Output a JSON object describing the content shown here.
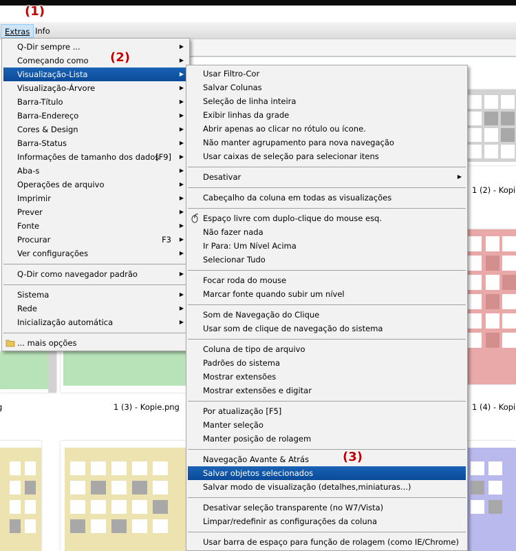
{
  "menubar": {
    "extras": "Extras",
    "info": "Info"
  },
  "annotations": {
    "one": "(1)",
    "two": "(2)",
    "three": "(3)"
  },
  "captions": {
    "c1": "1 (2) - Kopie",
    "c2": "1 (3) - Kopie.png",
    "c3": "1 (4) - Kopie",
    "c4": "g"
  },
  "extras_menu": {
    "items": [
      {
        "label": "Q-Dir sempre ...",
        "arrow": "▶"
      },
      {
        "label": "Começando como",
        "arrow": "▶"
      },
      {
        "label": "Visualização-Lista",
        "arrow": "▶"
      },
      {
        "label": "Visualização-Árvore",
        "arrow": "▶"
      },
      {
        "label": "Barra-Título",
        "arrow": "▶"
      },
      {
        "label": "Barra-Endereço",
        "arrow": "▶"
      },
      {
        "label": "Cores & Design",
        "arrow": "▶"
      },
      {
        "label": "Barra-Status",
        "arrow": "▶"
      },
      {
        "label": "Informações de tamanho dos dados",
        "shortcut": "[F9]",
        "arrow": "▶"
      },
      {
        "label": "Aba-s",
        "arrow": "▶"
      },
      {
        "label": "Operações de arquivo",
        "arrow": "▶"
      },
      {
        "label": "Imprimir",
        "arrow": "▶"
      },
      {
        "label": "Prever",
        "arrow": "▶"
      },
      {
        "label": "Fonte",
        "arrow": "▶"
      },
      {
        "label": "Procurar",
        "shortcut": "F3",
        "arrow": "▶"
      },
      {
        "label": "Ver configurações",
        "arrow": "▶"
      },
      {
        "label": "Q-Dir como navegador padrão",
        "arrow": "▶"
      },
      {
        "label": "Sistema",
        "arrow": "▶"
      },
      {
        "label": "Rede",
        "arrow": "▶"
      },
      {
        "label": "Inicialização automática",
        "arrow": "▶"
      },
      {
        "label": "... mais opções"
      }
    ]
  },
  "list_menu": {
    "items": [
      {
        "label": "Usar Filtro-Cor"
      },
      {
        "label": "Salvar Colunas"
      },
      {
        "label": "Seleção de linha inteira"
      },
      {
        "label": "Exibir linhas da grade"
      },
      {
        "label": "Abrir apenas ao clicar no rótulo ou ícone."
      },
      {
        "label": "Não manter agrupamento para nova navegação"
      },
      {
        "label": "Usar caixas de seleção para selecionar itens"
      },
      {
        "label": "Desativar",
        "arrow": "▶"
      },
      {
        "label": "Cabeçalho da coluna em todas as visualizações"
      },
      {
        "label": "Espaço livre com duplo-clique do mouse esq."
      },
      {
        "label": "Não fazer nada"
      },
      {
        "label": "Ir Para: Um Nível Acima"
      },
      {
        "label": "Selecionar Tudo"
      },
      {
        "label": "Focar roda do mouse"
      },
      {
        "label": "Marcar fonte quando subir um nível"
      },
      {
        "label": "Som de Navegação do Clique"
      },
      {
        "label": "Usar som de clique de navegação do sistema"
      },
      {
        "label": "Coluna de tipo de arquivo"
      },
      {
        "label": "Padrões do sistema"
      },
      {
        "label": "Mostrar extensões"
      },
      {
        "label": "Mostrar extensões e digitar"
      },
      {
        "label": "Por atualização [F5]"
      },
      {
        "label": "Manter seleção"
      },
      {
        "label": "Manter posição de rolagem"
      },
      {
        "label": "Navegação Avante & Atrás"
      },
      {
        "label": "Salvar objetos selecionados"
      },
      {
        "label": "Salvar modo de visualização (detalhes,miniaturas...)"
      },
      {
        "label": "Desativar seleção transparente (no W7/Vista)"
      },
      {
        "label": "Limpar/redefinir as configurações da coluna"
      },
      {
        "label": "Usar barra de espaço para função de rolagem (como IE/Chrome)"
      }
    ]
  },
  "colors": {
    "highlight": "#0a4a99",
    "annotation": "#c00000",
    "thumb_gray": "#d2d2d2",
    "thumb_red": "#e9a9a9",
    "thumb_green": "#b8e3b8",
    "thumb_yellow": "#ece3b0",
    "thumb_blue": "#b9b9ee"
  }
}
